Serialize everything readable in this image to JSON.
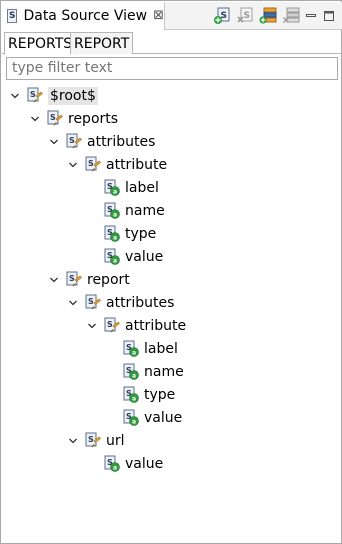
{
  "view": {
    "title": "Data Source View",
    "close_glyph": "⊠"
  },
  "tabs": [
    {
      "label": "REPORTS",
      "active": true
    },
    {
      "label": "REPORT",
      "active": false
    }
  ],
  "filter": {
    "placeholder": "type filter text",
    "value": ""
  },
  "tree": {
    "root": "$root$",
    "reports": "reports",
    "reports_attributes": "attributes",
    "reports_attribute": "attribute",
    "reports_attr_label": "label",
    "reports_attr_name": "name",
    "reports_attr_type": "type",
    "reports_attr_value": "value",
    "report": "report",
    "report_attributes": "attributes",
    "report_attribute": "attribute",
    "report_attr_label": "label",
    "report_attr_name": "name",
    "report_attr_type": "type",
    "report_attr_value": "value",
    "url": "url",
    "url_value": "value"
  },
  "colors": {
    "selection": "#e5e5e5",
    "icon_orange": "#e8a43a",
    "icon_green": "#2f9a3f",
    "icon_blue": "#3b6fb6"
  }
}
